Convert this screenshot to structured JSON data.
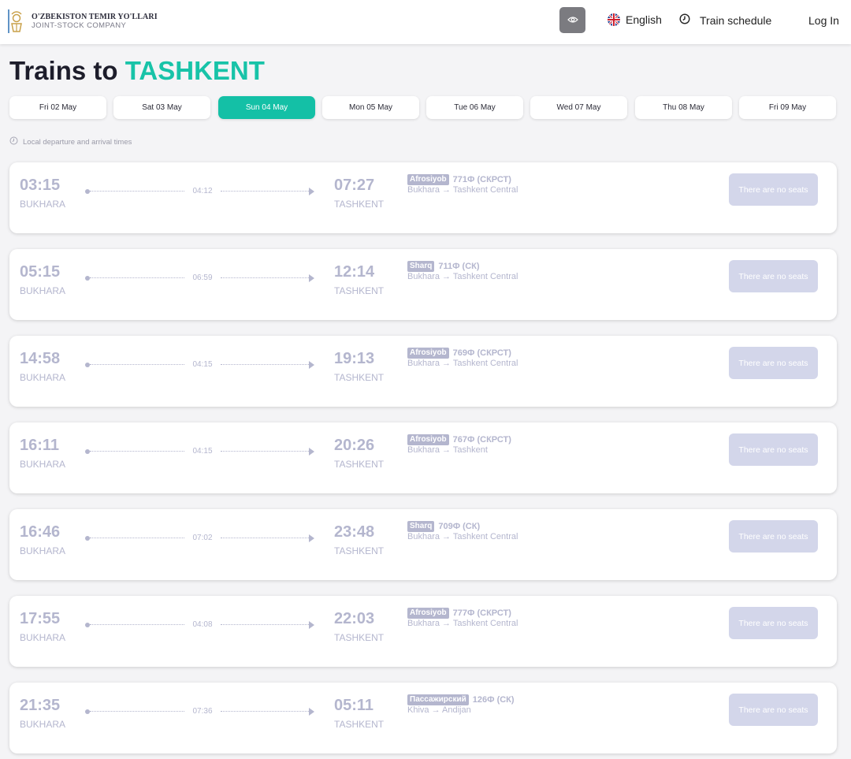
{
  "header": {
    "logo_line1": "O'ZBEKISTON TEMIR YO'LLARI",
    "logo_line2": "JOINT-STOCK COMPANY",
    "language": "English",
    "schedule": "Train schedule",
    "login": "Log In"
  },
  "title": {
    "prefix": "Trains to",
    "city": "TASHKENT"
  },
  "dates": [
    {
      "label": "Fri 02 May",
      "active": false
    },
    {
      "label": "Sat 03 May",
      "active": false
    },
    {
      "label": "Sun 04 May",
      "active": true
    },
    {
      "label": "Mon 05 May",
      "active": false
    },
    {
      "label": "Tue 06 May",
      "active": false
    },
    {
      "label": "Wed 07 May",
      "active": false
    },
    {
      "label": "Thu 08 May",
      "active": false
    },
    {
      "label": "Fri 09 May",
      "active": false
    }
  ],
  "note": "Local departure and arrival times",
  "no_seats_label": "There are no seats",
  "trains": [
    {
      "dep_time": "03:15",
      "dep_city": "BUKHARA",
      "duration": "04:12",
      "arr_time": "07:27",
      "arr_city": "TASHKENT",
      "brand": "Afrosiyob",
      "number": "771Ф (СКРСТ)",
      "route": "Bukhara → Tashkent Central"
    },
    {
      "dep_time": "05:15",
      "dep_city": "BUKHARA",
      "duration": "06:59",
      "arr_time": "12:14",
      "arr_city": "TASHKENT",
      "brand": "Sharq",
      "number": "711Ф (СК)",
      "route": "Bukhara → Tashkent Central"
    },
    {
      "dep_time": "14:58",
      "dep_city": "BUKHARA",
      "duration": "04:15",
      "arr_time": "19:13",
      "arr_city": "TASHKENT",
      "brand": "Afrosiyob",
      "number": "769Ф (СКРСТ)",
      "route": "Bukhara → Tashkent Central"
    },
    {
      "dep_time": "16:11",
      "dep_city": "BUKHARA",
      "duration": "04:15",
      "arr_time": "20:26",
      "arr_city": "TASHKENT",
      "brand": "Afrosiyob",
      "number": "767Ф (СКРСТ)",
      "route": "Bukhara → Tashkent"
    },
    {
      "dep_time": "16:46",
      "dep_city": "BUKHARA",
      "duration": "07:02",
      "arr_time": "23:48",
      "arr_city": "TASHKENT",
      "brand": "Sharq",
      "number": "709Ф (СК)",
      "route": "Bukhara → Tashkent Central"
    },
    {
      "dep_time": "17:55",
      "dep_city": "BUKHARA",
      "duration": "04:08",
      "arr_time": "22:03",
      "arr_city": "TASHKENT",
      "brand": "Afrosiyob",
      "number": "777Ф (СКРСТ)",
      "route": "Bukhara → Tashkent Central"
    },
    {
      "dep_time": "21:35",
      "dep_city": "BUKHARA",
      "duration": "07:36",
      "arr_time": "05:11",
      "arr_city": "TASHKENT",
      "brand": "Пассажирский",
      "number": "126Ф (СК)",
      "route": "Khiva → Andijan"
    }
  ],
  "colors": {
    "accent": "#14c0a6",
    "muted": "#b4b6ce",
    "no_seats_bg": "#d3d6ea"
  }
}
